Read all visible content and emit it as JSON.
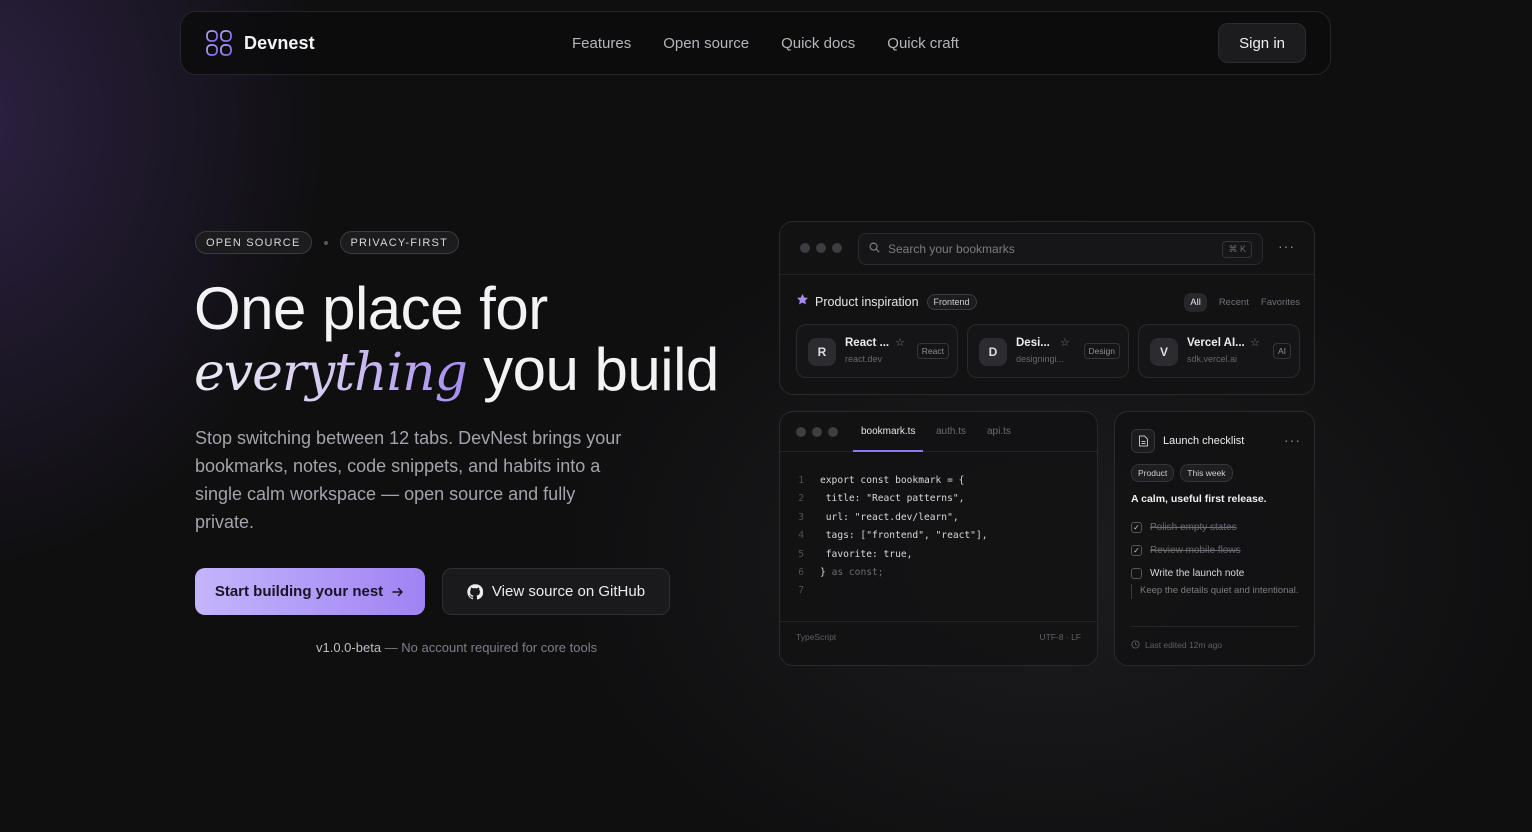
{
  "nav": {
    "brand": "Devnest",
    "links": [
      "Features",
      "Open source",
      "Quick docs",
      "Quick craft"
    ],
    "signin": "Sign in"
  },
  "hero": {
    "badges": [
      "OPEN SOURCE",
      "PRIVACY-FIRST"
    ],
    "headline_line1": "One place for",
    "headline_accent": "everything",
    "headline_line2_rest": " you build",
    "subtext": "Stop switching between 12 tabs. DevNest brings your bookmarks, notes, code snippets, and habits into a single calm workspace — open source and fully private.",
    "cta_primary": "Start building your nest",
    "cta_secondary": "View source on GitHub",
    "version": "v1.0.0-beta",
    "version_note": " — No account required for core tools"
  },
  "bookmarks_panel": {
    "search_placeholder": "Search your bookmarks",
    "shortcut": "⌘ K",
    "collection_title": "Product inspiration",
    "collection_tag": "Frontend",
    "filters": [
      "All",
      "Recent",
      "Favorites"
    ],
    "cards": [
      {
        "initial": "R",
        "title": "React ...",
        "url": "react.dev",
        "tag": "React"
      },
      {
        "initial": "D",
        "title": "Desi...",
        "url": "designingi...",
        "tag": "Design"
      },
      {
        "initial": "V",
        "title": "Vercel AI...",
        "url": "sdk.vercel.ai",
        "tag": "AI"
      }
    ]
  },
  "code_panel": {
    "tabs": [
      "bookmark.ts",
      "auth.ts",
      "api.ts"
    ],
    "lines": [
      {
        "n": "1",
        "code": "export const bookmark = {"
      },
      {
        "n": "2",
        "code": " title: \"React patterns\","
      },
      {
        "n": "3",
        "code": " url: \"react.dev/learn\","
      },
      {
        "n": "4",
        "code": " tags: [\"frontend\", \"react\"],"
      },
      {
        "n": "5",
        "code": " favorite: true,"
      },
      {
        "n": "6",
        "code": "} ",
        "dim": "as const;"
      },
      {
        "n": "7",
        "code": ""
      }
    ],
    "language": "TypeScript",
    "encoding": "UTF-8 · LF"
  },
  "checklist_panel": {
    "title": "Launch checklist",
    "tags": [
      "Product",
      "This week"
    ],
    "lead": "A calm, useful first release.",
    "items": [
      {
        "text": "Polish empty states",
        "done": true
      },
      {
        "text": "Review mobile flows",
        "done": true
      },
      {
        "text": "Write the launch note",
        "done": false
      }
    ],
    "quote": "Keep the details quiet and intentional.",
    "edited": "Last edited 12m ago"
  },
  "colors": {
    "accent": "#9f83f3",
    "background": "#0f0f10"
  },
  "icons": [
    "logo-icon",
    "arrow-right-icon",
    "github-icon",
    "search-icon",
    "more-icon",
    "star-icon",
    "doc-icon",
    "check-icon",
    "clock-icon"
  ]
}
